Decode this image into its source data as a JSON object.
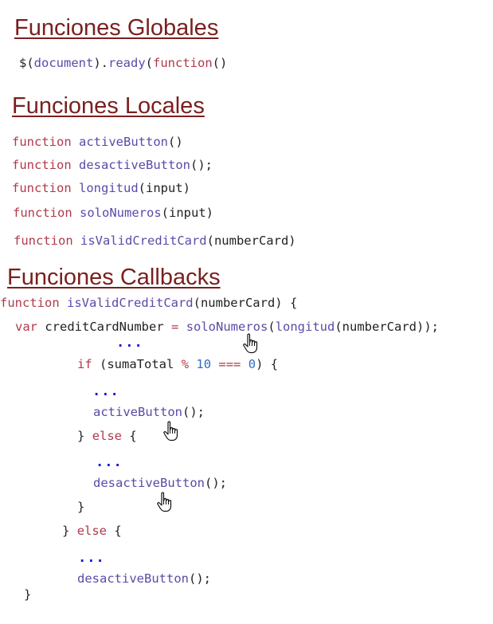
{
  "headings": {
    "globales": "Funciones Globales",
    "locales": "Funciones Locales",
    "callbacks": "Funciones Callbacks"
  },
  "globales": {
    "dollar": "$(",
    "document": "document",
    "close_dot": ").",
    "ready": "ready",
    "open_paren": "(",
    "function_kw": "function",
    "parens": "()"
  },
  "locales": [
    {
      "kw": "function",
      "name": "activeButton",
      "rest": "()"
    },
    {
      "kw": "function",
      "name": "desactiveButton",
      "rest": "();"
    },
    {
      "kw": "function",
      "name": "longitud",
      "rest": "(input)"
    },
    {
      "kw": "function",
      "name": "soloNumeros",
      "rest": "(input)"
    },
    {
      "kw": "function",
      "name": "isValidCreditCard",
      "rest": "(numberCard)"
    }
  ],
  "callbacks": {
    "l1": {
      "kw": "function",
      "name": "isValidCreditCard",
      "rest": "(numberCard) {"
    },
    "l2": {
      "kw": "var",
      "ident": "creditCardNumber",
      "eq": "=",
      "f1": "soloNumeros",
      "p1": "(",
      "f2": "longitud",
      "rest": "(numberCard));"
    },
    "dots": "...",
    "l3": {
      "kw": "if",
      "a": "(sumaTotal",
      "op1": "%",
      "n1": "10",
      "op2": "===",
      "n2": "0",
      "b": ") {"
    },
    "l4": {
      "name": "activeButton",
      "rest": "();"
    },
    "l5": {
      "a": "}",
      "kw": "else",
      "b": "{"
    },
    "l6": {
      "name": "desactiveButton",
      "rest": "();"
    },
    "l7": "}",
    "l8": {
      "a": "}",
      "kw": "else",
      "b": "{"
    },
    "l9": {
      "name": "desactiveButton",
      "rest": "();"
    },
    "l10": "}"
  },
  "icons": {
    "cursor": "hand-pointer-icon"
  }
}
